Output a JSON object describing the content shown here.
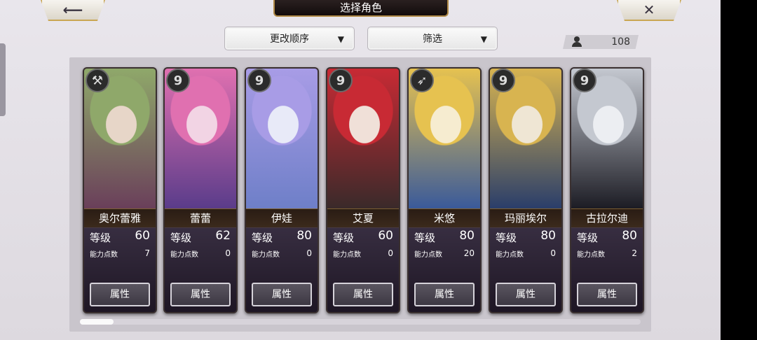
{
  "header": {
    "title": "选择角色",
    "back_icon": "arrow-left-icon",
    "close_icon": "close-x-icon"
  },
  "controls": {
    "sort_label": "更改顺序",
    "filter_label": "筛选",
    "caret": "▼"
  },
  "roster": {
    "count": "108",
    "icon": "user-icon"
  },
  "labels": {
    "level": "等级",
    "ability_points": "能力点数",
    "attributes": "属性"
  },
  "characters": [
    {
      "name": "奥尔蕾雅",
      "level": "60",
      "ap": "7",
      "weapon": "axe",
      "weapon_glyph": "⚒",
      "palette": [
        "#e7d6c8",
        "#8fa86a",
        "#6a3f5a"
      ]
    },
    {
      "name": "蕾蕾",
      "level": "62",
      "ap": "0",
      "weapon": "staff",
      "weapon_glyph": "9",
      "palette": [
        "#f2d4e4",
        "#e070b0",
        "#5a3c8a"
      ]
    },
    {
      "name": "伊娃",
      "level": "80",
      "ap": "0",
      "weapon": "staff",
      "weapon_glyph": "9",
      "palette": [
        "#e8eaf8",
        "#a89ce6",
        "#6e7fc8"
      ]
    },
    {
      "name": "艾夏",
      "level": "60",
      "ap": "0",
      "weapon": "staff",
      "weapon_glyph": "9",
      "palette": [
        "#f0e0d8",
        "#c82a34",
        "#3a2a2a"
      ]
    },
    {
      "name": "米悠",
      "level": "80",
      "ap": "20",
      "weapon": "bow",
      "weapon_glyph": "➶",
      "palette": [
        "#f6ecd0",
        "#e6c250",
        "#3a5a9a"
      ]
    },
    {
      "name": "玛丽埃尔",
      "level": "80",
      "ap": "0",
      "weapon": "staff",
      "weapon_glyph": "9",
      "palette": [
        "#efe6d4",
        "#d8b450",
        "#2a3e6a"
      ]
    },
    {
      "name": "古拉尔迪",
      "level": "80",
      "ap": "2",
      "weapon": "staff",
      "weapon_glyph": "9",
      "palette": [
        "#eceef2",
        "#c4c8d0",
        "#1c1c24"
      ]
    }
  ]
}
